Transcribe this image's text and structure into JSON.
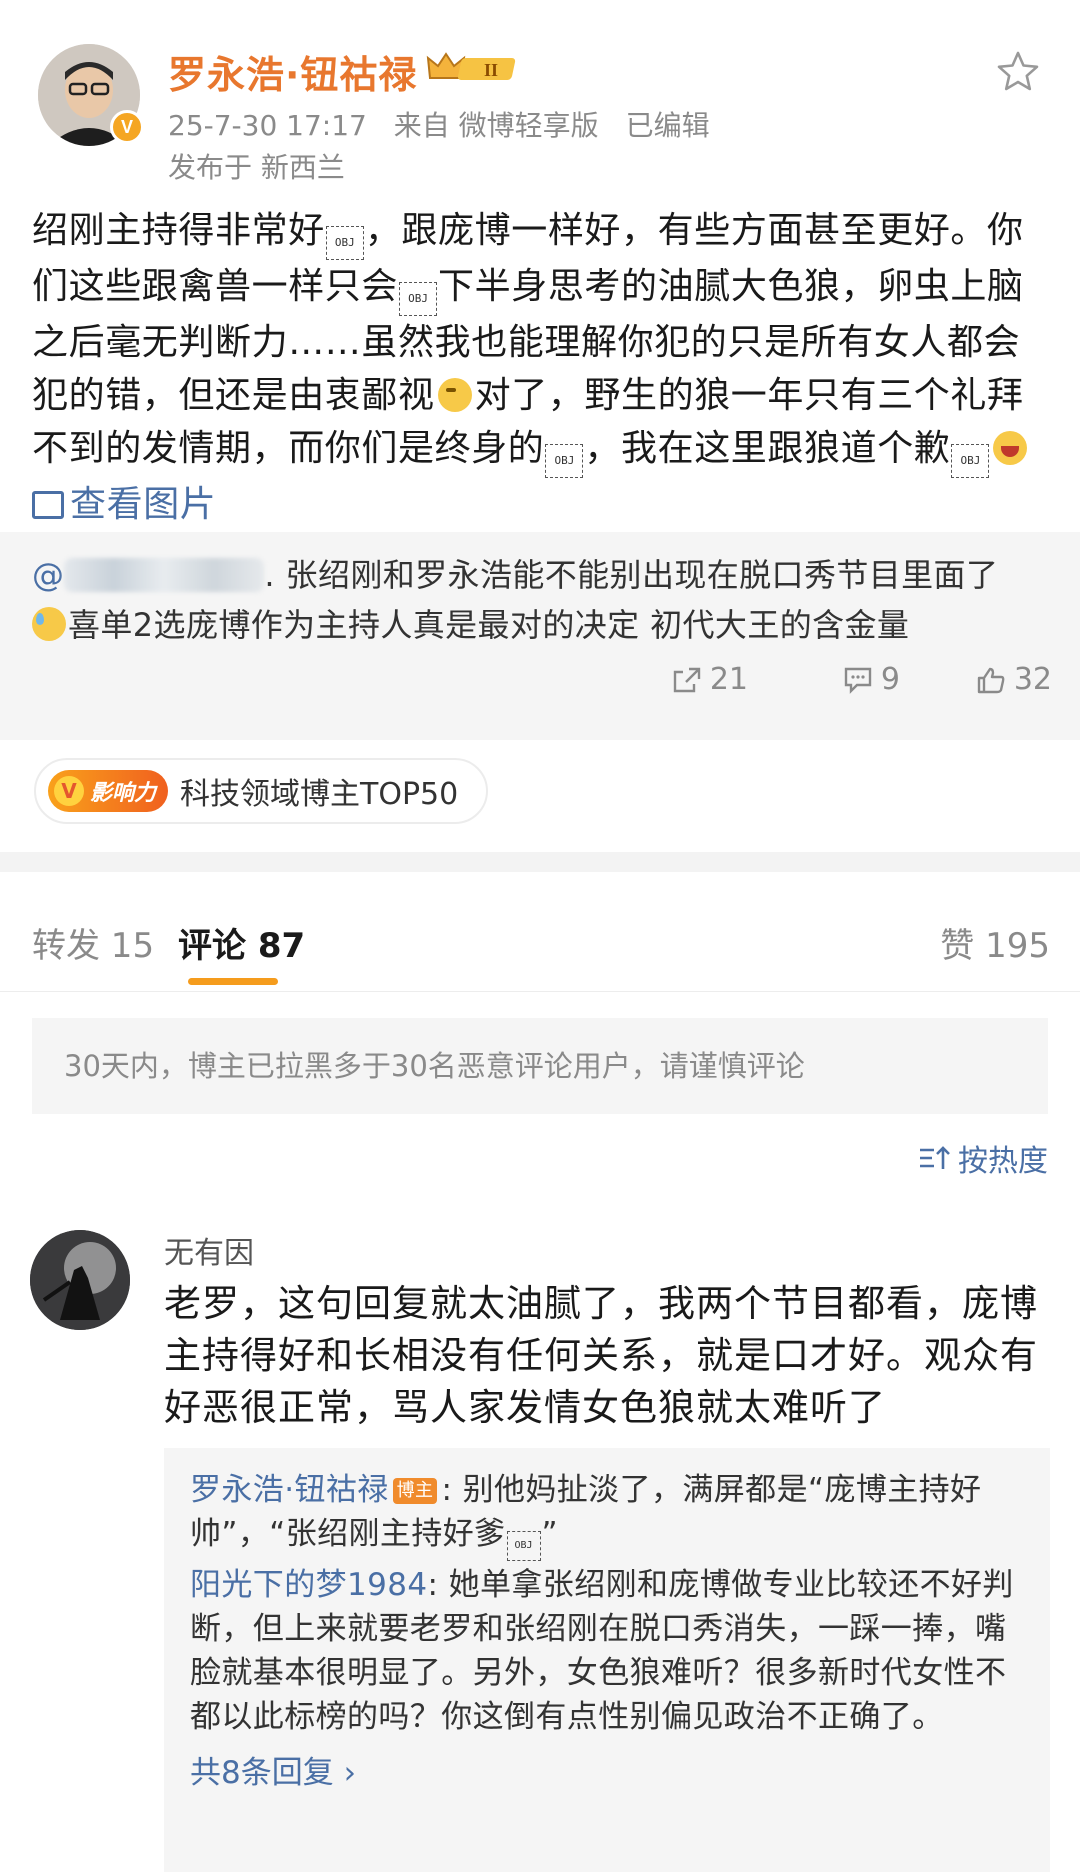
{
  "post": {
    "author": "罗永浩·钮祜禄",
    "level_badge": "II",
    "timestamp": "25-7-30 17:17",
    "source": "来自 微博轻享版",
    "edited": "已编辑",
    "location": "发布于 新西兰",
    "body": {
      "p1": "绍刚主持得非常好",
      "p2": "，跟庞博一样好，有些方面甚至更好。你们这些跟禽兽一样只会",
      "p3": "下半身思考的油腻大色狼，卵虫上脑之后毫无判断力……虽然我也能理解你犯的只是所有女人都会犯的错，但还是由衷鄙视",
      "p4": "对了，野生的狼一年只有三个礼拜不到的发情期，而你们是终身的",
      "p5": "，我在这里跟狼道个歉",
      "obj": "OBJ",
      "view_pictures": "查看图片"
    }
  },
  "repost": {
    "at": "@",
    "text_a": ". 张绍刚和罗永浩能不能别出现在脱口秀节目里面了",
    "text_b": "喜单2选庞博作为主持人真是最对的决定 初代大王的含金量",
    "shares": "21",
    "comments": "9",
    "likes": "32"
  },
  "influence": {
    "tag": "影响力",
    "text": "科技领域博主TOP50"
  },
  "tabs": {
    "repost": "转发 15",
    "comment": "评论 87",
    "like": "赞 195"
  },
  "notice": "30天内，博主已拉黑多于30名恶意评论用户，请谨慎评论",
  "sort": "按热度",
  "comment": {
    "name": "无有因",
    "text": "老罗，这句回复就太油腻了，我两个节目都看，庞博主持得好和长相没有任何关系，就是口才好。观众有好恶很正常，骂人家发情女色狼就太难听了",
    "replies": [
      {
        "name": "罗永浩·钮祜禄",
        "badge": "博主",
        "text_a": ": 别他妈扯淡了，满屏都是“庞博主持好帅”，“张绍刚主持好爹",
        "text_b": "”"
      },
      {
        "name": "阳光下的梦1984",
        "text": ": 她单拿张绍刚和庞博做专业比较还不好判断，但上来就要老罗和张绍刚在脱口秀消失，一踩一捧，嘴脸就基本很明显了。另外，女色狼难听？很多新时代女性不都以此标榜的吗？你这倒有点性别偏见政治不正确了。"
      }
    ],
    "more": "共8条回复 ›"
  }
}
